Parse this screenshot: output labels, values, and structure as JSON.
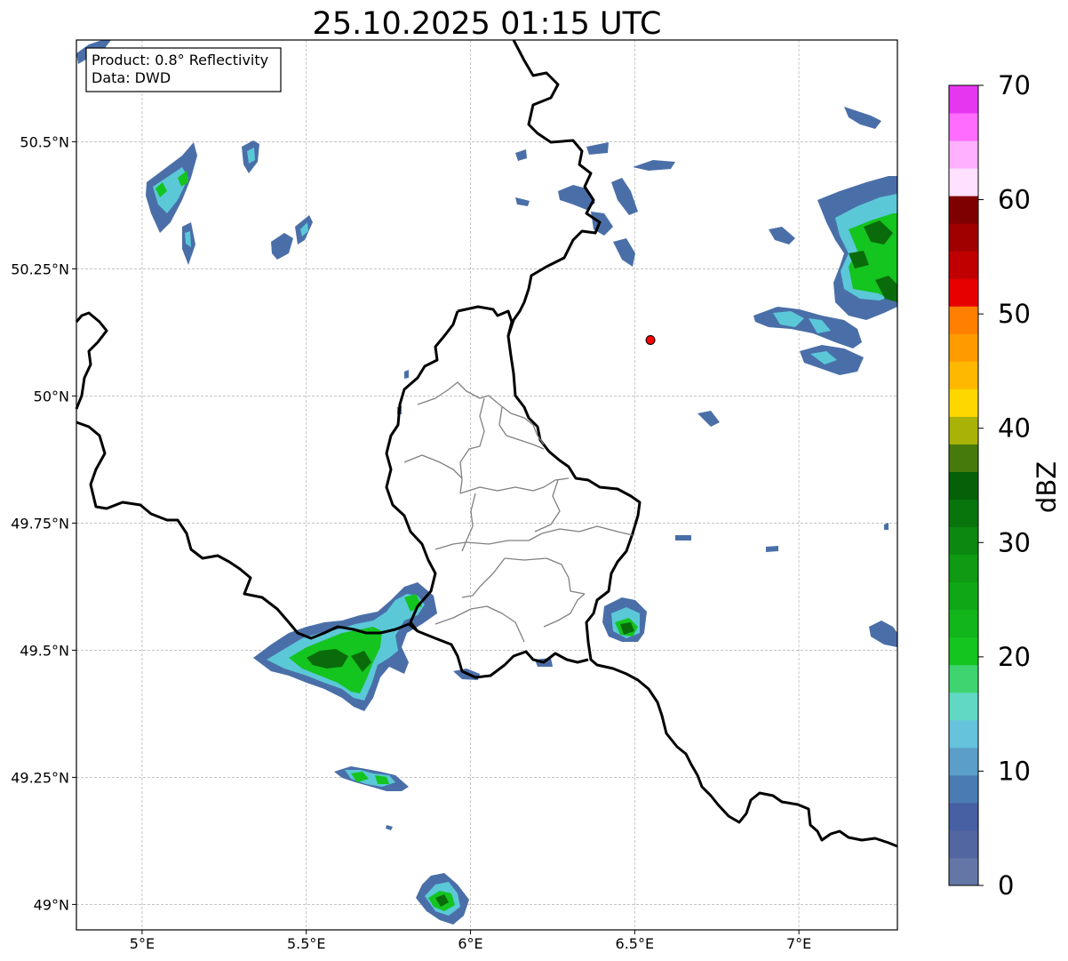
{
  "title": "25.10.2025 01:15 UTC",
  "info_box": {
    "product_line": "Product: 0.8° Reflectivity",
    "data_line": "Data: DWD"
  },
  "map": {
    "lon_range": [
      4.8,
      7.3
    ],
    "lat_range": [
      48.95,
      50.7
    ],
    "lon_ticks": [
      5.0,
      5.5,
      6.0,
      6.5,
      7.0
    ],
    "lon_tick_labels": [
      "5°E",
      "5.5°E",
      "6°E",
      "6.5°E",
      "7°E"
    ],
    "lat_ticks": [
      49.0,
      49.25,
      49.5,
      49.75,
      50.0,
      50.25,
      50.5
    ],
    "lat_tick_labels": [
      "49°N",
      "49.25°N",
      "49.5°N",
      "49.75°N",
      "50°N",
      "50.25°N",
      "50.5°N"
    ],
    "grid": true,
    "radar_site": {
      "lon": 6.548,
      "lat": 50.11,
      "color": "#ff0000"
    },
    "echo_colors": {
      "weak": "#4a6fa8",
      "light": "#5bc8d8",
      "moderate": "#14c41f",
      "strong": "#0a6b0a"
    }
  },
  "colorbar": {
    "label": "dBZ",
    "min": 0,
    "max": 70,
    "ticks": [
      0,
      10,
      20,
      30,
      40,
      50,
      60,
      70
    ],
    "tick_labels": [
      "0",
      "10",
      "20",
      "30",
      "40",
      "50",
      "60",
      "70"
    ],
    "colors": [
      "#6476a6",
      "#5266a0",
      "#4660a3",
      "#4a7bb3",
      "#5b9ec8",
      "#66c3dc",
      "#61d8c3",
      "#3fd46f",
      "#14c41f",
      "#12b51a",
      "#10a716",
      "#0e9a12",
      "#0c8810",
      "#08750c",
      "#056008",
      "#477a0c",
      "#a8b207",
      "#ffd700",
      "#ffb800",
      "#ff9b00",
      "#ff7f00",
      "#e60000",
      "#c00000",
      "#a00000",
      "#7f0000",
      "#ffe0ff",
      "#ffb0ff",
      "#ff6cff",
      "#e636f0"
    ]
  }
}
